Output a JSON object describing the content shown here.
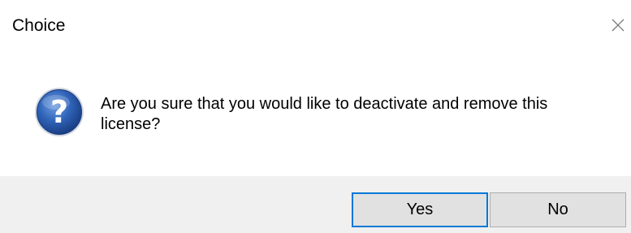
{
  "window": {
    "title": "Choice",
    "close_icon": "close-icon"
  },
  "dialog": {
    "icon": "question-icon",
    "message": "Are you sure that you would like to deactivate and remove this license?",
    "icon_color": "#2b5ba8"
  },
  "buttons": {
    "yes_label": "Yes",
    "no_label": "No",
    "default": "yes",
    "default_border_color": "#0078d7"
  }
}
